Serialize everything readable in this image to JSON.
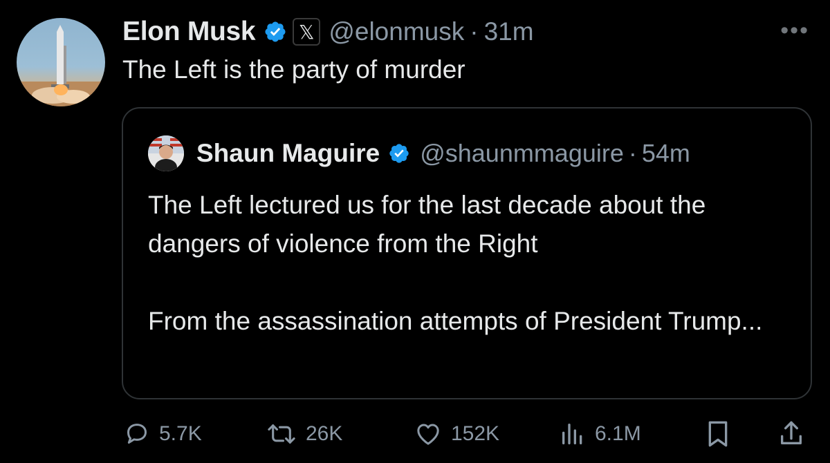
{
  "author": {
    "name": "Elon Musk",
    "handle": "@elonmusk",
    "time": "31m",
    "x_badge": "𝕏",
    "avatar_icon": "rocket-launch-icon"
  },
  "tweet": {
    "text": "The Left is the party of murder"
  },
  "more_icon": "•••",
  "quote": {
    "name": "Shaun Maguire",
    "handle": "@shaunmmaguire",
    "time": "54m",
    "paragraph1": "The Left lectured us for the last decade about the dangers of violence from the Right",
    "paragraph2": "From the assassination attempts of President Trump..."
  },
  "separator": "·",
  "metrics": {
    "replies": "5.7K",
    "reposts": "26K",
    "likes": "152K",
    "views": "6.1M"
  },
  "colors": {
    "background": "#000000",
    "text": "#e7e9ea",
    "secondary": "#8b98a5",
    "verified": "#1d9bf0",
    "border": "#2f3336"
  }
}
